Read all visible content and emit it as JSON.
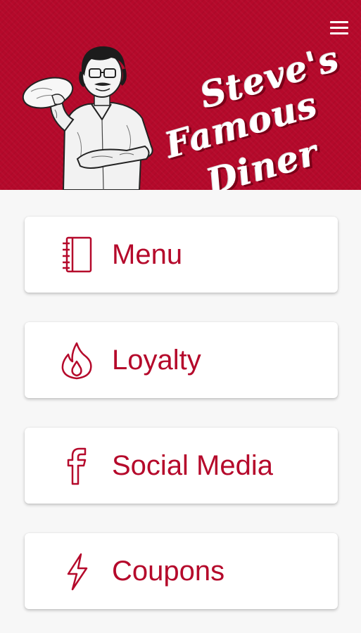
{
  "header": {
    "logo_lines": [
      "Steve's",
      "Famous",
      "Diner"
    ],
    "menu_icon": "hamburger-menu-icon"
  },
  "nav": {
    "items": [
      {
        "label": "Menu",
        "icon": "notebook-icon"
      },
      {
        "label": "Loyalty",
        "icon": "flame-icon"
      },
      {
        "label": "Social Media",
        "icon": "facebook-icon"
      },
      {
        "label": "Coupons",
        "icon": "lightning-bolt-icon"
      }
    ]
  },
  "colors": {
    "brand_red": "#b5092b",
    "button_bg": "#ffffff",
    "page_bg": "#f7f7f7"
  }
}
